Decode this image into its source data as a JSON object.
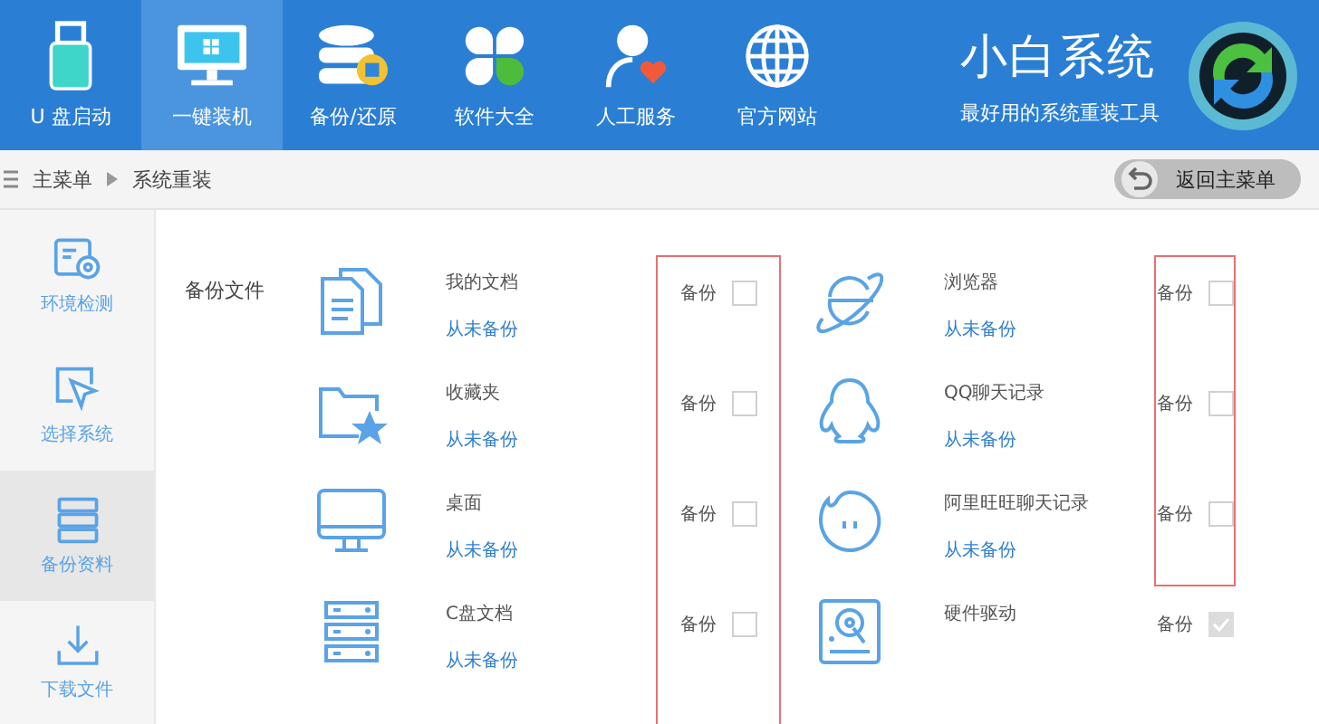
{
  "header": {
    "nav": [
      {
        "kind": "usb",
        "label": "U 盘启动",
        "selected": false
      },
      {
        "kind": "monitor",
        "label": "一键装机",
        "selected": true
      },
      {
        "kind": "database",
        "label": "备份/还原",
        "selected": false
      },
      {
        "kind": "apps",
        "label": "软件大全",
        "selected": false
      },
      {
        "kind": "person",
        "label": "人工服务",
        "selected": false
      },
      {
        "kind": "globe",
        "label": "官方网站",
        "selected": false
      }
    ],
    "brand": {
      "title": "小白系统",
      "subtitle": "最好用的系统重装工具"
    }
  },
  "breadcrumb": {
    "items": [
      "主菜单",
      "系统重装"
    ],
    "back_button": "返回主菜单"
  },
  "sidebar": {
    "items": [
      {
        "kind": "check",
        "label": "环境检测",
        "selected": false
      },
      {
        "kind": "pointer",
        "label": "选择系统",
        "selected": false
      },
      {
        "kind": "server",
        "label": "备份资料",
        "selected": true
      },
      {
        "kind": "download",
        "label": "下载文件",
        "selected": false
      }
    ]
  },
  "backup": {
    "section_label": "备份文件",
    "columns": [
      {
        "items": [
          {
            "kind": "documents",
            "name": "我的文档",
            "status": "从未备份",
            "check_label": "备份",
            "checked": false,
            "disabled": false,
            "highlighted": true
          },
          {
            "kind": "favorites",
            "name": "收藏夹",
            "status": "从未备份",
            "check_label": "备份",
            "checked": false,
            "disabled": false,
            "highlighted": true
          },
          {
            "kind": "desktop",
            "name": "桌面",
            "status": "从未备份",
            "check_label": "备份",
            "checked": false,
            "disabled": false,
            "highlighted": true
          },
          {
            "kind": "drive",
            "name": "C盘文档",
            "status": "从未备份",
            "check_label": "备份",
            "checked": false,
            "disabled": false,
            "highlighted": true
          }
        ]
      },
      {
        "items": [
          {
            "kind": "browser",
            "name": "浏览器",
            "status": "从未备份",
            "check_label": "备份",
            "checked": false,
            "disabled": false,
            "highlighted": true
          },
          {
            "kind": "penguin",
            "name": "QQ聊天记录",
            "status": "从未备份",
            "check_label": "备份",
            "checked": false,
            "disabled": false,
            "highlighted": true
          },
          {
            "kind": "chat",
            "name": "阿里旺旺聊天记录",
            "status": "从未备份",
            "check_label": "备份",
            "checked": false,
            "disabled": false,
            "highlighted": true
          },
          {
            "kind": "hardware",
            "name": "硬件驱动",
            "check_label": "备份",
            "checked": true,
            "disabled": true,
            "highlighted": false
          }
        ]
      }
    ]
  }
}
